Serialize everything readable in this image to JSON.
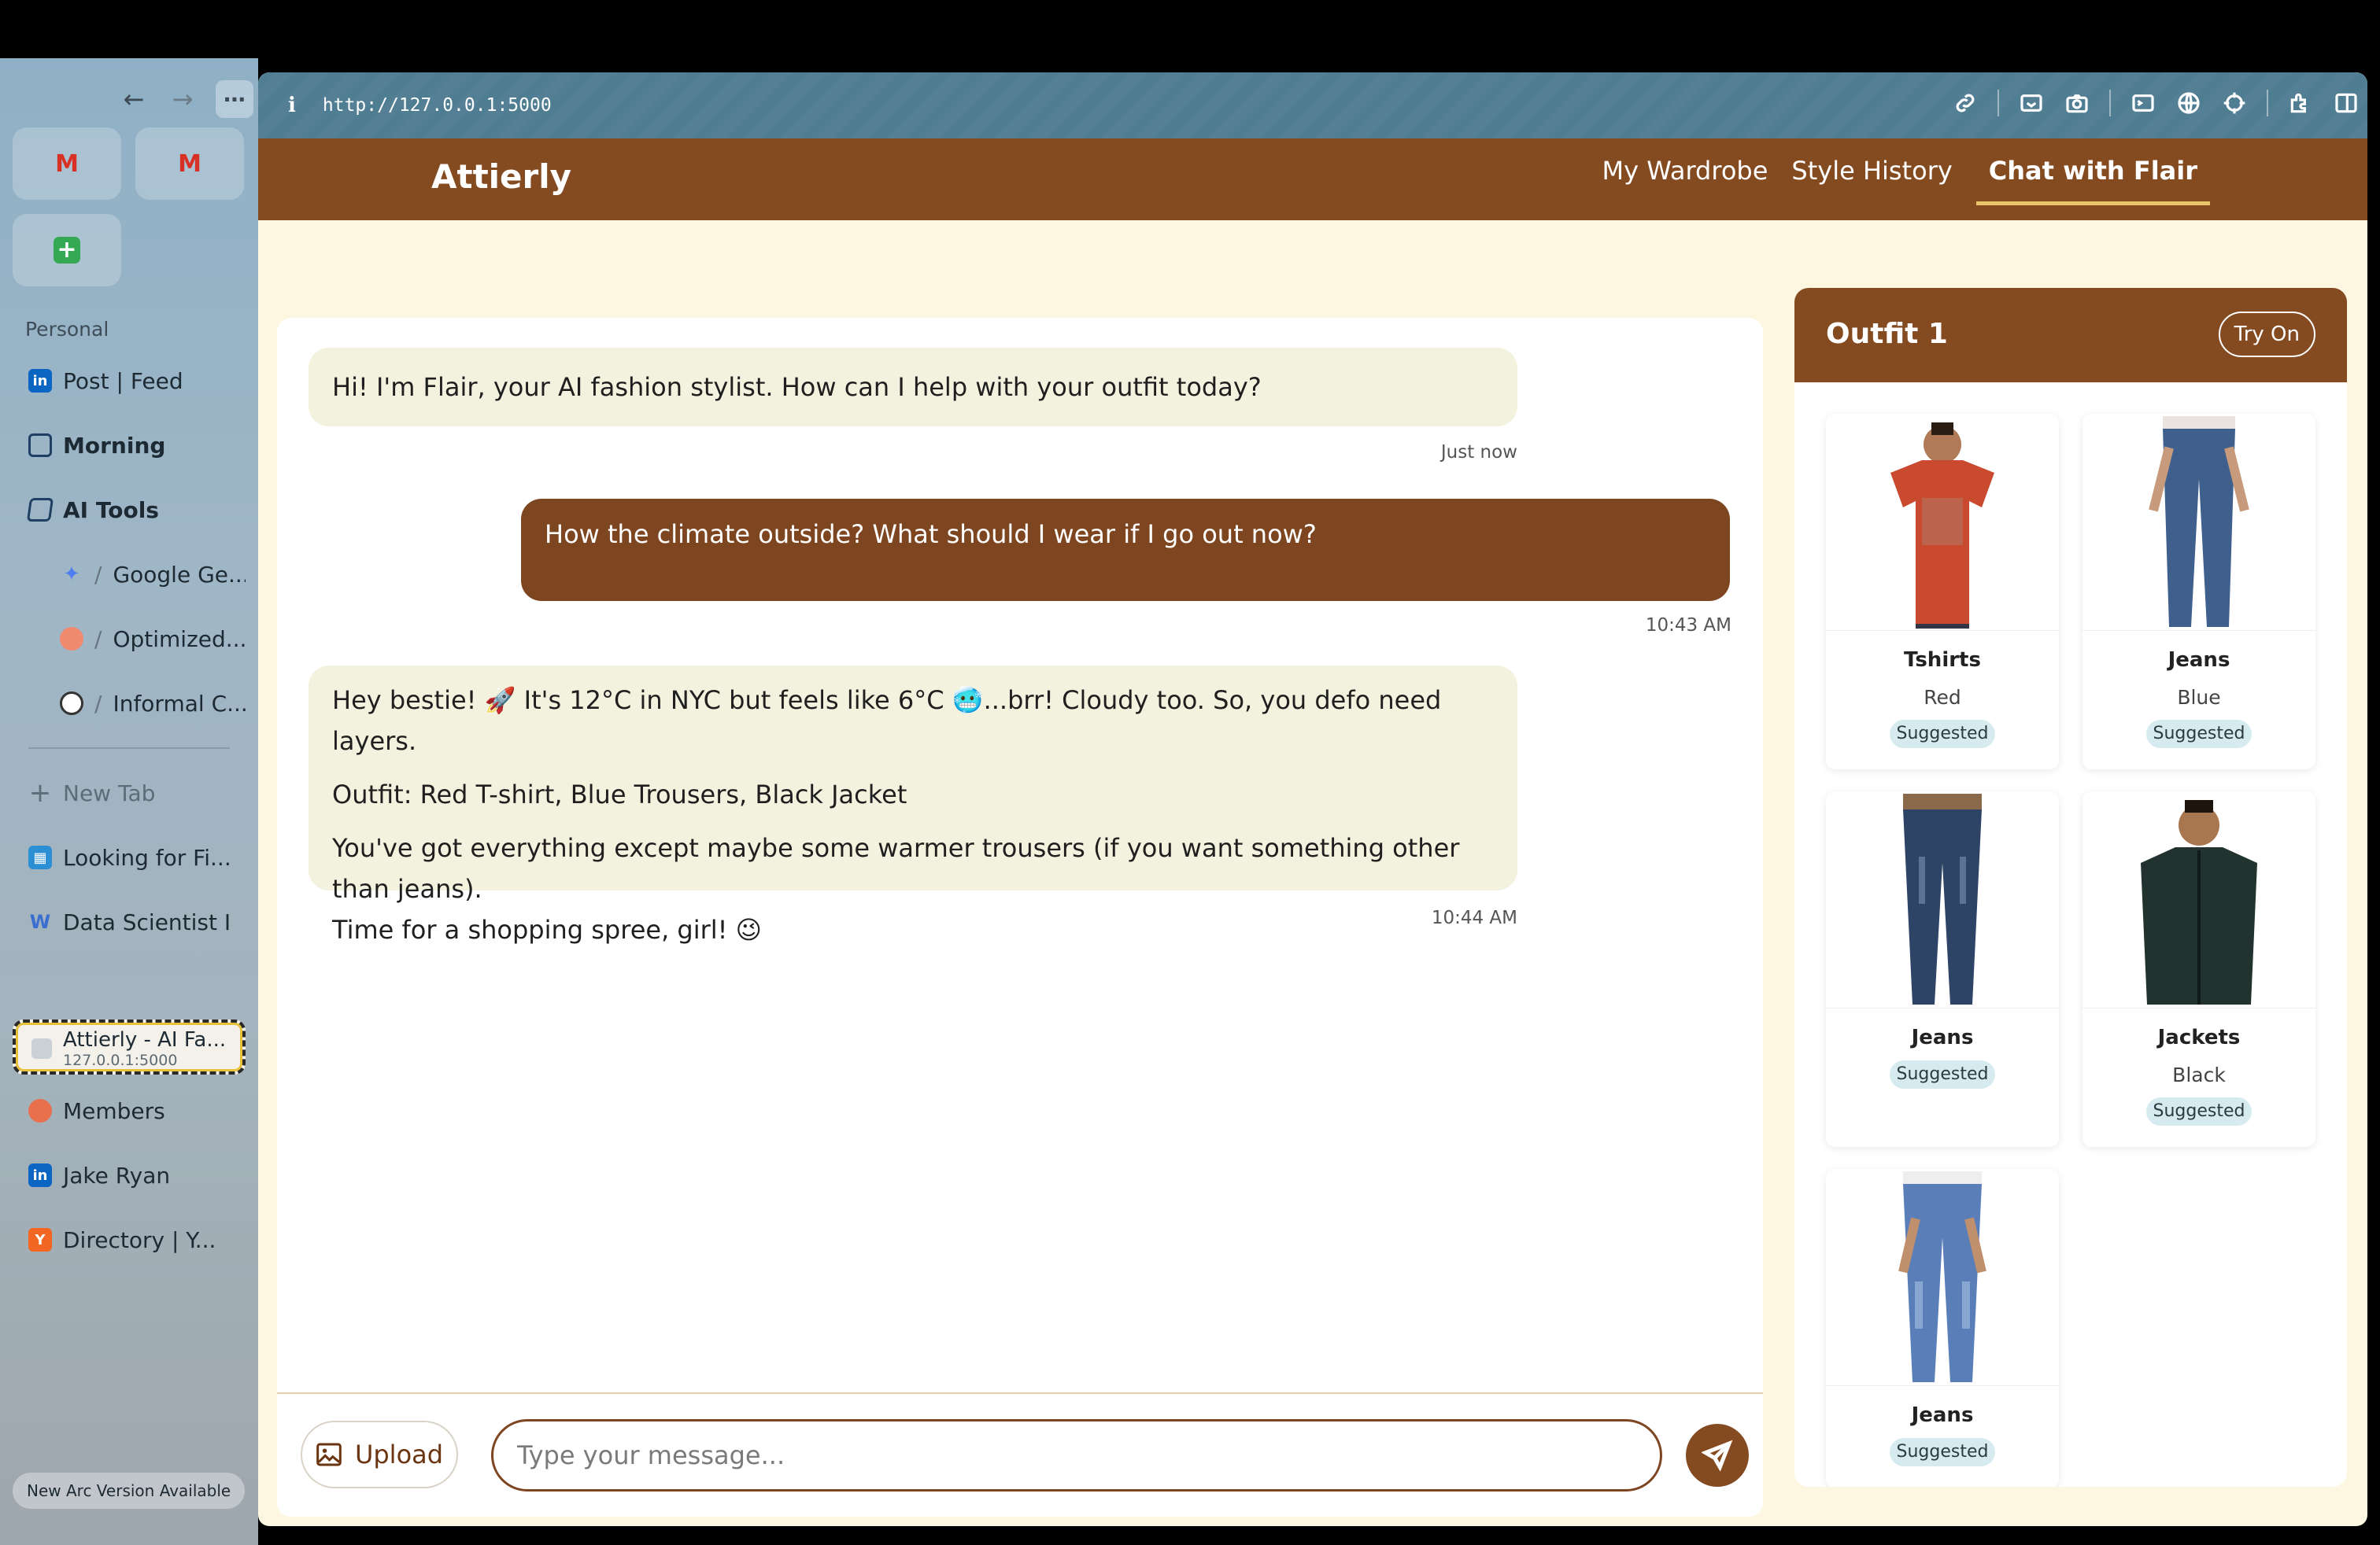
{
  "browser": {
    "url": "http://127.0.0.1:5000",
    "info_icon": "i"
  },
  "sidebar": {
    "section_label": "Personal",
    "items": [
      {
        "label": "Post | Feed",
        "icon": "linkedin-icon"
      },
      {
        "label": "Morning",
        "icon": "folder-icon"
      },
      {
        "label": "AI Tools",
        "icon": "folder-open-icon"
      },
      {
        "label": "Google Ge...",
        "icon": "gemini-icon"
      },
      {
        "label": "Optimized...",
        "icon": "site-icon"
      },
      {
        "label": "Informal C...",
        "icon": "openai-icon"
      },
      {
        "label": "New Tab",
        "icon": "plus-icon"
      },
      {
        "label": "Looking for Fi...",
        "icon": "grid-icon"
      },
      {
        "label": "Data Scientist I",
        "icon": "w-icon"
      },
      {
        "label": "Members",
        "icon": "members-icon"
      },
      {
        "label": "Jake Ryan",
        "icon": "linkedin-icon"
      },
      {
        "label": "Directory | Y...",
        "icon": "y-icon"
      }
    ],
    "active_tab": {
      "title": "Attierly - AI Fa...",
      "subtitle": "127.0.0.1:5000"
    },
    "update_label": "New Arc Version Available"
  },
  "app": {
    "brand": "Attierly",
    "nav": [
      "My Wardrobe",
      "Style History",
      "Chat with Flair"
    ],
    "active_nav": "Chat with Flair"
  },
  "chat": {
    "messages": [
      {
        "role": "bot",
        "lines": [
          "Hi! I'm Flair, your AI fashion stylist. How can I help with your outfit today?"
        ],
        "time": "Just now"
      },
      {
        "role": "user",
        "lines": [
          "How the climate outside? What should I wear if I go out now?"
        ],
        "time": "10:43 AM"
      },
      {
        "role": "bot",
        "lines": [
          "Hey bestie! 🚀 It's 12°C in NYC but feels like 6°C 🥶...brr! Cloudy too. So, you defo need layers.",
          "Outfit: Red T-shirt, Blue Trousers, Black Jacket",
          "You've got everything except maybe some warmer trousers (if you want something other than jeans).",
          "Time for a shopping spree, girl! 😉"
        ],
        "time": "10:44 AM"
      }
    ],
    "upload_label": "Upload",
    "input_placeholder": "Type your message..."
  },
  "outfit": {
    "title": "Outfit 1",
    "try_on_label": "Try On",
    "items": [
      {
        "name": "Tshirts",
        "color": "Red",
        "badge": "Suggested",
        "kind": "tshirt",
        "hex": "#c94a2f"
      },
      {
        "name": "Jeans",
        "color": "Blue",
        "badge": "Suggested",
        "kind": "jeans",
        "hex": "#3f5f8d"
      },
      {
        "name": "Jeans",
        "color": "",
        "badge": "Suggested",
        "kind": "jeans",
        "hex": "#2e4466"
      },
      {
        "name": "Jackets",
        "color": "Black",
        "badge": "Suggested",
        "kind": "jacket",
        "hex": "#22332f"
      },
      {
        "name": "Jeans",
        "color": "",
        "badge": "Suggested",
        "kind": "jeans",
        "hex": "#5a7fb8"
      }
    ]
  },
  "colors": {
    "brand_brown": "#844a20",
    "cream": "#fdf6e1",
    "bot_bubble": "#f3f2df",
    "badge_bg": "#d6ebf0"
  }
}
